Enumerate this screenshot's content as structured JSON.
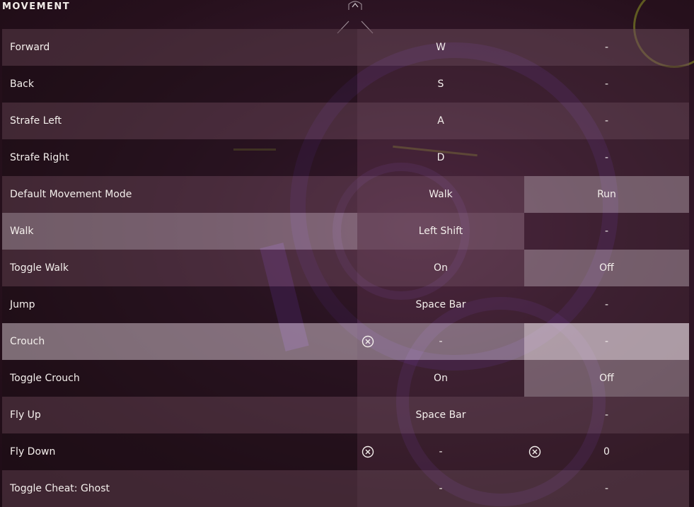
{
  "section": {
    "title": "MOVEMENT"
  },
  "icons": {
    "scroll_up": "chevron-up-icon",
    "clear": "clear-x-circle-icon"
  },
  "bindings": [
    {
      "action": "Forward",
      "primary": "W",
      "secondary": "-"
    },
    {
      "action": "Back",
      "primary": "S",
      "secondary": "-"
    },
    {
      "action": "Strafe Left",
      "primary": "A",
      "secondary": "-"
    },
    {
      "action": "Strafe Right",
      "primary": "D",
      "secondary": "-"
    },
    {
      "action": "Default Movement Mode",
      "primary": "Walk",
      "secondary": "Run"
    },
    {
      "action": "Walk",
      "primary": "Left Shift",
      "secondary": "-"
    },
    {
      "action": "Toggle Walk",
      "primary": "On",
      "secondary": "Off"
    },
    {
      "action": "Jump",
      "primary": "Space Bar",
      "secondary": "-"
    },
    {
      "action": "Crouch",
      "primary": "-",
      "secondary": "-"
    },
    {
      "action": "Toggle Crouch",
      "primary": "On",
      "secondary": "Off"
    },
    {
      "action": "Fly Up",
      "primary": "Space Bar",
      "secondary": "-"
    },
    {
      "action": "Fly Down",
      "primary": "-",
      "secondary": "0"
    },
    {
      "action": "Toggle Cheat: Ghost",
      "primary": "-",
      "secondary": "-"
    }
  ]
}
